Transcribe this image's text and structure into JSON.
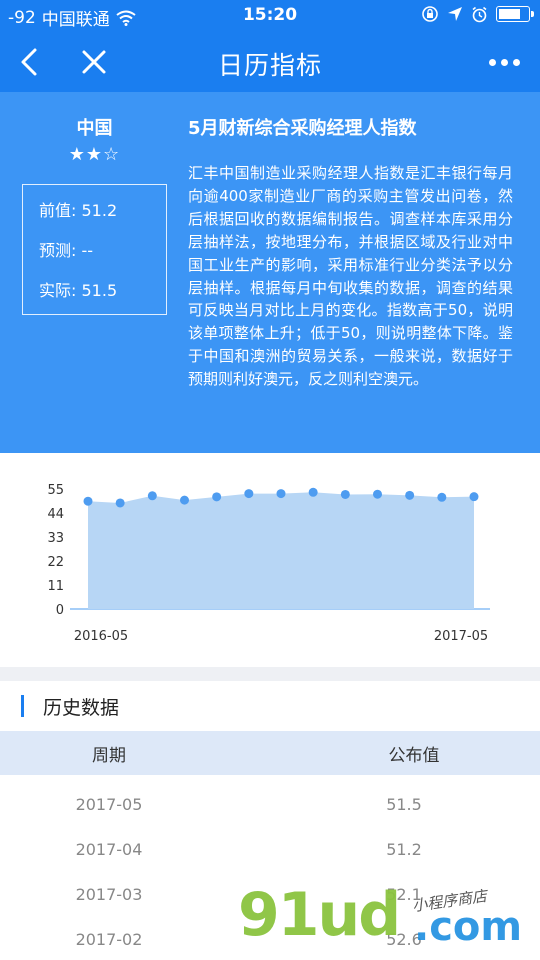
{
  "status_bar": {
    "signal": "-92",
    "carrier": "中国联通",
    "time": "15:20",
    "battery_level": 0.75
  },
  "nav": {
    "title": "日历指标"
  },
  "indicator": {
    "country": "中国",
    "stars": "★★☆",
    "star_rating": 2,
    "star_max": 3,
    "previous_label": "前值:",
    "previous_value": "51.2",
    "forecast_label": "预测:",
    "forecast_value": "--",
    "actual_label": "实际:",
    "actual_value": "51.5",
    "title": "5月财新综合采购经理人指数",
    "description": "汇丰中国制造业采购经理人指数是汇丰银行每月向逾400家制造业厂商的采购主管发出问卷，然后根据回收的数据编制报告。调查样本库采用分层抽样法，按地理分布，并根据区域及行业对中国工业生产的影响，采用标准行业分类法予以分层抽样。根据每月中旬收集的数据，调查的结果可反映当月对比上月的变化。指数高于50，说明该单项整体上升；低于50，则说明整体下降。鉴于中国和澳洲的贸易关系，一般来说，数据好于预期则利好澳元，反之则利空澳元。"
  },
  "chart_data": {
    "type": "area",
    "x": [
      "2016-05",
      "2016-06",
      "2016-07",
      "2016-08",
      "2016-09",
      "2016-10",
      "2016-11",
      "2016-12",
      "2017-01",
      "2017-02",
      "2017-03",
      "2017-04",
      "2017-05"
    ],
    "values": [
      49.4,
      48.6,
      51.9,
      49.9,
      51.4,
      52.9,
      52.9,
      53.5,
      52.5,
      52.6,
      52.1,
      51.2,
      51.5
    ],
    "yticks": [
      "0",
      "11",
      "22",
      "33",
      "44",
      "55"
    ],
    "ylim": [
      0,
      55
    ],
    "x_tick_labels": [
      "2016-05",
      "2017-05"
    ],
    "fill_color": "#b7d6f5",
    "marker_color": "#4e9cf0",
    "grid": false
  },
  "history": {
    "title": "历史数据",
    "col_period": "周期",
    "col_value": "公布值",
    "rows": [
      {
        "period": "2017-05",
        "value": "51.5"
      },
      {
        "period": "2017-04",
        "value": "51.2"
      },
      {
        "period": "2017-03",
        "value": "52.1"
      },
      {
        "period": "2017-02",
        "value": "52.6"
      }
    ]
  },
  "watermark": {
    "logo": "91ud",
    "domain": ".com",
    "tagline": "小程序商店"
  },
  "colors": {
    "primary": "#1a7ef0",
    "panel": "#3c95f5",
    "table_header": "#dde8f8"
  }
}
